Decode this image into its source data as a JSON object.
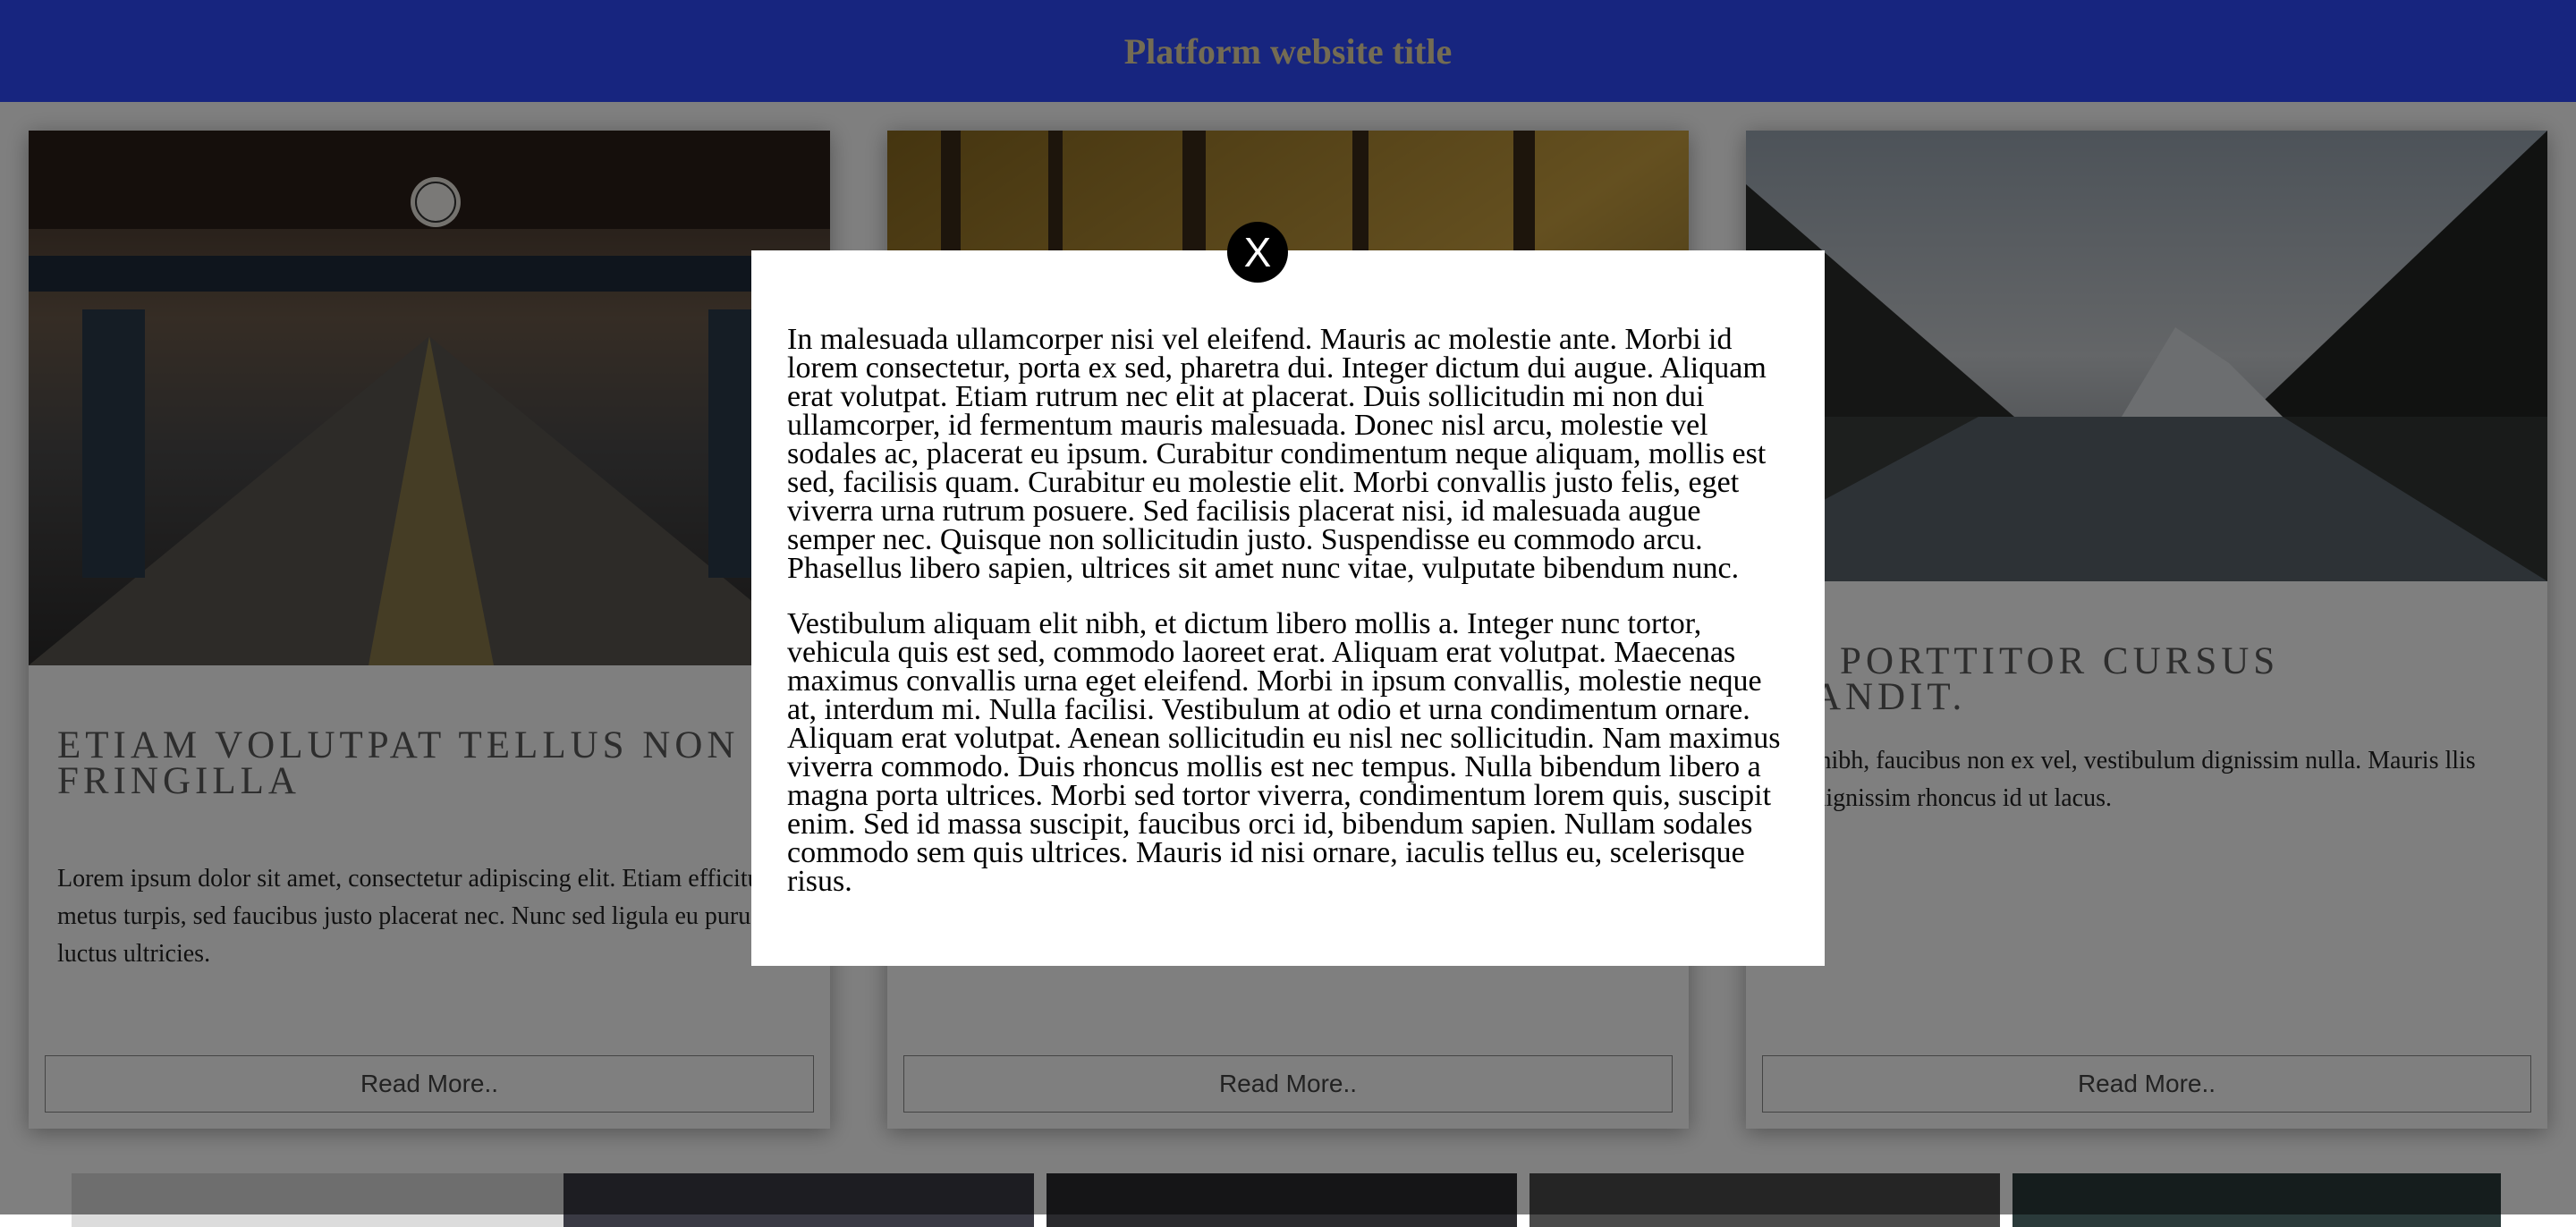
{
  "header": {
    "title": "Platform website title"
  },
  "cards": [
    {
      "title": "ETIAM VOLUTPAT TELLUS NON FRINGILLA",
      "text": "Lorem ipsum dolor sit amet, consectetur adipiscing elit. Etiam efficitur metus turpis, sed faucibus justo placerat nec. Nunc sed ligula eu purus luctus ultricies.",
      "button": "Read More.."
    },
    {
      "title": "",
      "text": "",
      "button": "Read More.."
    },
    {
      "title": "AM PORTTITOR CURSUS BLANDIT.",
      "text": "e sem nibh, faucibus non ex vel, vestibulum dignissim nulla. Mauris llis ut mi dignissim rhoncus id ut lacus.",
      "button": "Read More.."
    }
  ],
  "modal": {
    "close_label": "X",
    "paragraphs": [
      "In malesuada ullamcorper nisi vel eleifend. Mauris ac molestie ante. Morbi id lorem consectetur, porta ex sed, pharetra dui. Integer dictum dui augue. Aliquam erat volutpat. Etiam rutrum nec elit at placerat. Duis sollicitudin mi non dui ullamcorper, id fermentum mauris malesuada. Donec nisl arcu, molestie vel sodales ac, placerat eu ipsum. Curabitur condimentum neque aliquam, mollis est sed, facilisis quam. Curabitur eu molestie elit. Morbi convallis justo felis, eget viverra urna rutrum posuere. Sed facilisis placerat nisi, id malesuada augue semper nec. Quisque non sollicitudin justo. Suspendisse eu commodo arcu. Phasellus libero sapien, ultrices sit amet nunc vitae, vulputate bibendum nunc.",
      "Vestibulum aliquam elit nibh, et dictum libero mollis a. Integer nunc tortor, vehicula quis est sed, commodo laoreet erat. Aliquam erat volutpat. Maecenas maximus convallis urna eget eleifend. Morbi in ipsum convallis, molestie neque at, interdum mi. Nulla facilisi. Vestibulum at odio et urna condimentum ornare. Aliquam erat volutpat. Aenean sollicitudin eu nisl nec sollicitudin. Nam maximus viverra commodo. Duis rhoncus mollis est nec tempus. Nulla bibendum libero a magna porta ultrices. Morbi sed tortor viverra, condimentum lorem quis, suscipit enim. Sed id massa suscipit, faucibus orci id, bibendum sapien. Nullam sodales commodo sem quis ultrices. Mauris id nisi ornare, iaculis tellus eu, scelerisque risus."
    ]
  },
  "colors": {
    "header_bg": "#2f4bff",
    "header_title": "#e9d9a6",
    "overlay": "rgba(0,0,0,0.5)",
    "close_button": "#000000"
  },
  "images": [
    "train-station-photo",
    "autumn-forest-photo",
    "mountain-lake-photo"
  ]
}
